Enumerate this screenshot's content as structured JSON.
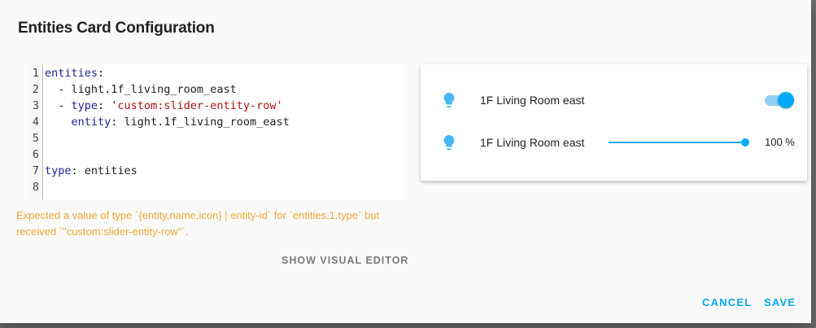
{
  "dialog": {
    "title": "Entities Card Configuration"
  },
  "editor": {
    "lines": [
      {
        "num": "1",
        "parts": [
          {
            "t": "entities",
            "c": "k"
          },
          {
            "t": ":",
            "c": ""
          }
        ]
      },
      {
        "num": "2",
        "parts": [
          {
            "t": "  - light.1f_living_room_east",
            "c": ""
          }
        ]
      },
      {
        "num": "3",
        "parts": [
          {
            "t": "  - ",
            "c": ""
          },
          {
            "t": "type",
            "c": "k"
          },
          {
            "t": ": ",
            "c": ""
          },
          {
            "t": "'custom:slider-entity-row'",
            "c": "s"
          }
        ]
      },
      {
        "num": "4",
        "parts": [
          {
            "t": "    ",
            "c": ""
          },
          {
            "t": "entity",
            "c": "k"
          },
          {
            "t": ": light.1f_living_room_east",
            "c": ""
          }
        ]
      },
      {
        "num": "5",
        "parts": []
      },
      {
        "num": "6",
        "parts": []
      },
      {
        "num": "7",
        "parts": [
          {
            "t": "type",
            "c": "k"
          },
          {
            "t": ": entities",
            "c": ""
          }
        ]
      },
      {
        "num": "8",
        "parts": []
      }
    ]
  },
  "error_text": "Expected a value of type `{entity,name,icon} | entity-id` for `entities.1.type` but received `\"custom:slider-entity-row\"`.",
  "show_visual_label": "SHOW VISUAL EDITOR",
  "preview": {
    "rows": [
      {
        "icon": "lightbulb-icon",
        "name": "1F Living Room east",
        "toggle_on": true
      },
      {
        "icon": "lightbulb-icon",
        "name": "1F Living Room east",
        "slider_value": 1.0,
        "value_text": "100 %"
      }
    ]
  },
  "buttons": {
    "cancel": "CANCEL",
    "save": "SAVE"
  },
  "colors": {
    "accent": "#03a9f4",
    "error": "#f4a533",
    "keyword": "#20209a",
    "string": "#aa1111"
  }
}
